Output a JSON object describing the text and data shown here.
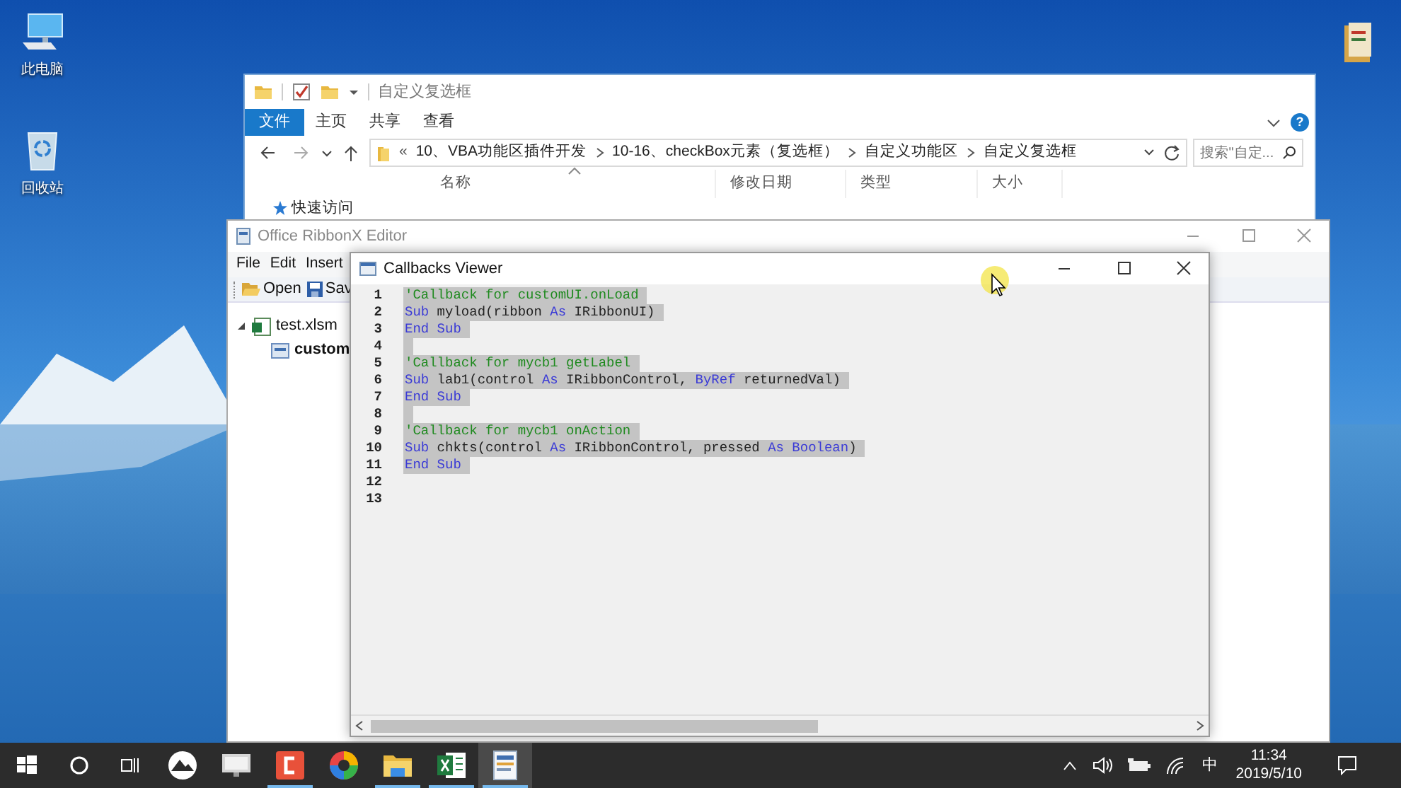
{
  "desktop_icons": [
    {
      "kind": "computer",
      "label": "此电脑"
    },
    {
      "kind": "recycle",
      "label": "回收站"
    },
    {
      "kind": "files"
    }
  ],
  "explorer": {
    "title": "自定义复选框",
    "tabs": [
      {
        "label": "文件",
        "selected": true
      },
      {
        "label": "主页",
        "selected": false
      },
      {
        "label": "共享",
        "selected": false
      },
      {
        "label": "查看",
        "selected": false
      }
    ],
    "path_prefix": "«",
    "path": [
      "10、VBA功能区插件开发",
      "10-16、checkBox元素（复选框）",
      "自定义功能区",
      "自定义复选框"
    ],
    "search_placeholder": "搜索\"自定...",
    "help": "?",
    "columns": [
      "名称",
      "修改日期",
      "类型",
      "大小"
    ],
    "nav": [
      {
        "label": "快速访问"
      }
    ]
  },
  "ribbonx": {
    "title": "Office RibbonX Editor",
    "menu": [
      "File",
      "Edit",
      "Insert"
    ],
    "toolbar": [
      {
        "kind": "open",
        "label": "Open"
      },
      {
        "kind": "save",
        "label": "Sav"
      }
    ],
    "tree": [
      {
        "label": "test.xlsm",
        "expanded": true,
        "children": [
          {
            "label": "custom"
          }
        ]
      }
    ]
  },
  "callbacks": {
    "title": "Callbacks Viewer",
    "lines": [
      {
        "number": "1",
        "selected": true,
        "tokens": [
          {
            "kind": "comment",
            "text": "'Callback for customUI.onLoad"
          }
        ]
      },
      {
        "number": "2",
        "selected": true,
        "tokens": [
          {
            "kind": "keyword",
            "text": "Sub"
          },
          {
            "kind": "plain",
            "text": " myload(ribbon "
          },
          {
            "kind": "keyword",
            "text": "As"
          },
          {
            "kind": "plain",
            "text": " IRibbonUI)"
          }
        ]
      },
      {
        "number": "3",
        "selected": true,
        "tokens": [
          {
            "kind": "keyword",
            "text": "End Sub"
          }
        ]
      },
      {
        "number": "4",
        "selected": true
      },
      {
        "number": "5",
        "selected": true,
        "tokens": [
          {
            "kind": "comment",
            "text": "'Callback for mycb1 getLabel"
          }
        ]
      },
      {
        "number": "6",
        "selected": true,
        "tokens": [
          {
            "kind": "keyword",
            "text": "Sub"
          },
          {
            "kind": "plain",
            "text": " lab1(control "
          },
          {
            "kind": "keyword",
            "text": "As"
          },
          {
            "kind": "plain",
            "text": " IRibbonControl, "
          },
          {
            "kind": "keyword",
            "text": "ByRef"
          },
          {
            "kind": "plain",
            "text": " returnedVal)"
          }
        ]
      },
      {
        "number": "7",
        "selected": true,
        "tokens": [
          {
            "kind": "keyword",
            "text": "End Sub"
          }
        ]
      },
      {
        "number": "8",
        "selected": true
      },
      {
        "number": "9",
        "selected": true,
        "tokens": [
          {
            "kind": "comment",
            "text": "'Callback for mycb1 onAction"
          }
        ]
      },
      {
        "number": "10",
        "selected": true,
        "tokens": [
          {
            "kind": "keyword",
            "text": "Sub"
          },
          {
            "kind": "plain",
            "text": " chkts(control "
          },
          {
            "kind": "keyword",
            "text": "As"
          },
          {
            "kind": "plain",
            "text": " IRibbonControl, pressed "
          },
          {
            "kind": "keyword",
            "text": "As Boolean"
          },
          {
            "kind": "plain",
            "text": ")"
          }
        ]
      },
      {
        "number": "11",
        "selected": true,
        "tokens": [
          {
            "kind": "keyword",
            "text": "End Sub"
          }
        ]
      },
      {
        "number": "12",
        "selected": false
      },
      {
        "number": "13",
        "selected": false
      }
    ]
  },
  "taskbar": {
    "apps": [
      {
        "kind": "mountain",
        "running": false,
        "selected": false
      },
      {
        "kind": "monitor",
        "running": false,
        "selected": false
      },
      {
        "kind": "bracket",
        "running": true,
        "selected": false
      },
      {
        "kind": "wheel",
        "running": false,
        "selected": false
      },
      {
        "kind": "folder",
        "running": true,
        "selected": false
      },
      {
        "kind": "excel",
        "running": true,
        "selected": false
      },
      {
        "kind": "document",
        "running": true,
        "selected": true
      }
    ],
    "ime": "中",
    "time": "11:34",
    "date": "2019/5/10"
  }
}
